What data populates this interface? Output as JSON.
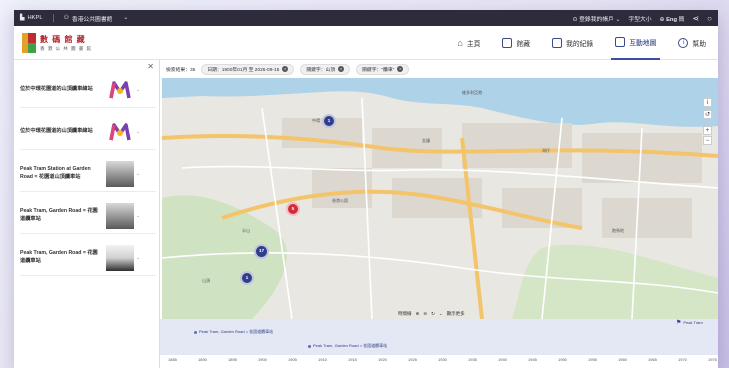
{
  "topbar": {
    "brand": "HKPL",
    "library": "香港公共圖書館",
    "account": "登錄我的帳戶",
    "font_size": "字型大小",
    "lang": "Eng",
    "lang2": "簡"
  },
  "header": {
    "logo_line1": "數 碼 館 藏",
    "logo_line2": "香 港 公 共 圖 書 館",
    "nav": [
      {
        "label": "主頁"
      },
      {
        "label": "館藏"
      },
      {
        "label": "我的紀錄"
      },
      {
        "label": "互動地圖"
      },
      {
        "label": "幫助"
      }
    ]
  },
  "results": {
    "count_label": "檢索結果：35",
    "chips": [
      {
        "label": "日期：1900年01月 至 2025-09-15"
      },
      {
        "label": "關鍵字：山頂"
      },
      {
        "label": "關鍵字：\"纜車\""
      }
    ]
  },
  "side_items": [
    {
      "title": "位於中環花園道的山頂纜車總站",
      "thumb": "logo"
    },
    {
      "title": "位於中環花園道的山頂纜車總站",
      "thumb": "logo"
    },
    {
      "title": "Peak Tram Station at Garden Road = 花園道山頂纜車站",
      "thumb": "photo"
    },
    {
      "title": "Peak Tram, Garden Road = 花園道纜車站",
      "thumb": "photo"
    },
    {
      "title": "Peak Tram, Garden Road = 花園道纜車站",
      "thumb": "photo-dark"
    }
  ],
  "map": {
    "clusters": [
      {
        "count": "1",
        "color": "#2f3d8c"
      },
      {
        "count": "5",
        "color": "#d62b3a"
      },
      {
        "count": "17",
        "color": "#2f3d8c"
      },
      {
        "count": "1",
        "color": "#2f3d8c"
      }
    ],
    "labels": [
      "中環",
      "金鐘",
      "灣仔",
      "香港公園",
      "山頂",
      "半山",
      "維多利亞港",
      "跑馬地"
    ],
    "bottom_bar": "時間線",
    "show_more": "顯示更多"
  },
  "timeline": {
    "events": [
      {
        "label": "Peak Tram, Garden Road = 花園道纜車站"
      },
      {
        "label": "Peak Tram, Garden Road = 花園道纜車站"
      },
      {
        "label": "Peak Tram"
      }
    ],
    "years": [
      "1885",
      "1890",
      "1895",
      "1900",
      "1905",
      "1910",
      "1915",
      "1920",
      "1925",
      "1930",
      "1935",
      "1940",
      "1945",
      "1950",
      "1955",
      "1960",
      "1965",
      "1970",
      "1975"
    ]
  },
  "colors": {
    "accent": "#2f3d8c",
    "red": "#d62b3a",
    "topbar": "#2e2c3c"
  }
}
